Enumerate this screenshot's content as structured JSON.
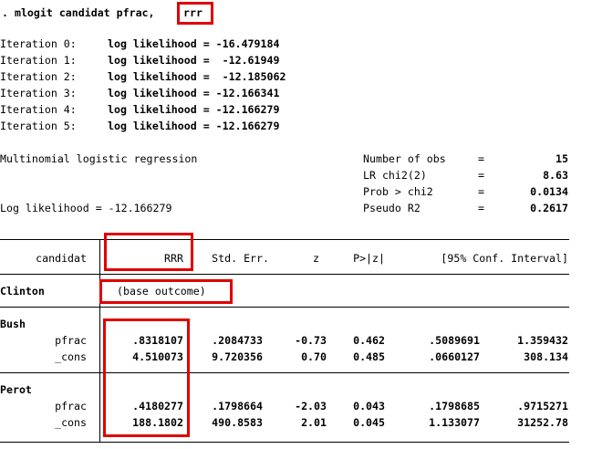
{
  "command": {
    "prefix": ". mlogit candidat pfrac,",
    "option": "rrr"
  },
  "iterations": [
    {
      "label": "Iteration 0:",
      "text": "log likelihood = -16.479184"
    },
    {
      "label": "Iteration 1:",
      "text": "log likelihood =  -12.61949"
    },
    {
      "label": "Iteration 2:",
      "text": "log likelihood =  -12.185062"
    },
    {
      "label": "Iteration 3:",
      "text": "log likelihood = -12.166341"
    },
    {
      "label": "Iteration 4:",
      "text": "log likelihood = -12.166279"
    },
    {
      "label": "Iteration 5:",
      "text": "log likelihood = -12.166279"
    }
  ],
  "model_title": "Multinomial logistic regression",
  "log_likelihood": "Log likelihood = -12.166279",
  "stats": [
    {
      "label": "Number of obs",
      "eq": "=",
      "value": "15"
    },
    {
      "label": "LR chi2(2)",
      "eq": "=",
      "value": "8.63"
    },
    {
      "label": "Prob > chi2",
      "eq": "=",
      "value": "0.0134"
    },
    {
      "label": "Pseudo R2",
      "eq": "=",
      "value": "0.2617"
    }
  ],
  "table": {
    "headers": {
      "var": "candidat",
      "coef": "RRR",
      "se": "Std. Err.",
      "z": "z",
      "p": "P>|z|",
      "ci": "[95% Conf. Interval]"
    },
    "base_label": "Clinton",
    "base_note": "(base outcome)",
    "groups": [
      {
        "name": "Bush",
        "rows": [
          {
            "var": "pfrac",
            "coef": ".8318107",
            "se": ".2084733",
            "z": "-0.73",
            "p": "0.462",
            "lo": ".5089691",
            "hi": "1.359432"
          },
          {
            "var": "_cons",
            "coef": "4.510073",
            "se": "9.720356",
            "z": "0.70",
            "p": "0.485",
            "lo": ".0660127",
            "hi": "308.134"
          }
        ]
      },
      {
        "name": "Perot",
        "rows": [
          {
            "var": "pfrac",
            "coef": ".4180277",
            "se": ".1798664",
            "z": "-2.03",
            "p": "0.043",
            "lo": ".1798685",
            "hi": ".9715271"
          },
          {
            "var": "_cons",
            "coef": "188.1802",
            "se": "490.8583",
            "z": "2.01",
            "p": "0.045",
            "lo": "1.133077",
            "hi": "31252.78"
          }
        ]
      }
    ]
  },
  "colors": {
    "highlight": "#e00000",
    "text": "#000000",
    "background": "#ffffff"
  }
}
